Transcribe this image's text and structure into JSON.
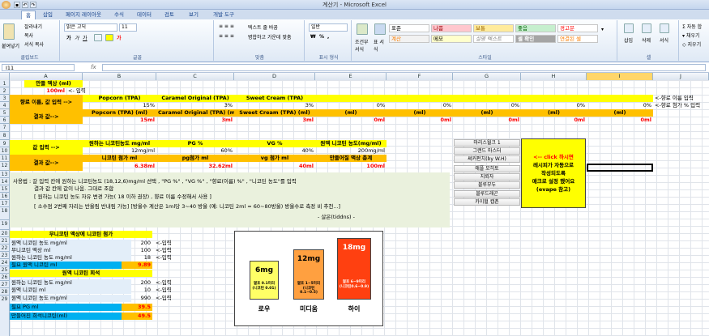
{
  "app": {
    "window_title": "계산기 - Microsoft Excel",
    "office_button": "office-orb",
    "quick_access": [
      "save-icon",
      "undo-icon",
      "redo-icon"
    ]
  },
  "ribbon": {
    "tabs": [
      "홈",
      "삽입",
      "페이지 레이아웃",
      "수식",
      "데이터",
      "검토",
      "보기",
      "개발 도구"
    ],
    "clipboard": {
      "paste": "붙여넣기",
      "cut": "잘라내기",
      "copy": "복사",
      "format_painter": "서식 복사",
      "label": "클립보드"
    },
    "font": {
      "name": "맑은 고딕",
      "size": "11",
      "label": "글꼴"
    },
    "align": {
      "wrap": "텍스트 줄 바꿈",
      "merge": "병합하고 가운데 맞춤",
      "label": "맞춤"
    },
    "number": {
      "format": "일반",
      "currency": "₩",
      "percent": "%",
      "label": "표시 형식"
    },
    "styles": {
      "conditional": "조건부 서식",
      "table": "표 서식",
      "standard": "표준",
      "bad": "나쁨",
      "good": "보통",
      "neutral": "좋음",
      "warning": "경고문",
      "calc": "계산",
      "memo": "메모",
      "explain": "설명 텍스트",
      "check": "셀 확인",
      "linked": "연결된 셀",
      "label": "스타일"
    },
    "cells": {
      "insert": "삽입",
      "delete": "삭제",
      "format": "서식",
      "label": "셀"
    },
    "editing": {
      "autosum": "자동 합",
      "fill": "채우기",
      "clear": "지우기"
    }
  },
  "formula_bar": {
    "name_box": "I11",
    "fx": "fx",
    "value": ""
  },
  "columns": [
    "A",
    "B",
    "C",
    "D",
    "E",
    "F",
    "G",
    "H",
    "I",
    "J"
  ],
  "rows": [
    "1",
    "2",
    "3",
    "4",
    "5",
    "6",
    "7",
    "8",
    "9",
    "10",
    "11",
    "12",
    "13",
    "14",
    "15",
    "16",
    "17",
    "18",
    "19",
    "20",
    "21",
    "22",
    "23",
    "24",
    "25",
    "26",
    "27",
    "28",
    "29"
  ],
  "sheet": {
    "r1": "만들 액상 (ml)",
    "r2_val": "100ml",
    "r2_note": "<- 입력",
    "r3_label": "향료 이름, 값 입력 -->",
    "r3": [
      "Popcorn (TPA)",
      "Caramel Original (TPA)",
      "Sweet Cream (TPA)"
    ],
    "r4": [
      "15%",
      "3%",
      "3%",
      "0%",
      "0%",
      "0%",
      "0%",
      "0%"
    ],
    "r5_label": "결과 값-->",
    "r5": [
      "Popcorn (TPA) (ml)",
      "Caramel Original (TPA) (ml)",
      "Sweet Cream (TPA) (ml)",
      "(ml)",
      "(ml)",
      "(ml)",
      "(ml)",
      "(ml)"
    ],
    "r6": [
      "15ml",
      "3ml",
      "3ml",
      "0ml",
      "0ml",
      "0ml",
      "0ml",
      "0ml"
    ],
    "note_r3": "<-향료 이름 입력",
    "note_r4": "<-향료 첨가 % 입력",
    "r8": [
      "원하는 니코틴농도 mg/ml",
      "PG %",
      "VG %",
      "원액 니코틴 농도(mg/ml)"
    ],
    "r9_label": "값 입력 -->",
    "r9": [
      "12mg/ml",
      "60%",
      "40%",
      "200mg/ml"
    ],
    "r10": [
      "니코틴 첨가 ml",
      "pg첨가 ml",
      "vg 첨가 ml",
      "만들어질 액상 총계"
    ],
    "r11_label": "결과 값-->",
    "r11": [
      "6.38ml",
      "32.62ml",
      "40ml",
      "100ml"
    ],
    "help": [
      "사용법 : 갈 입력 칸에 원하는 니코틴농도 (18,12,6)mg/ml 선택 , \"PG %\" , \"VG %\" , \"향료(이름) %\" , \"니코틴 농도\"를 입력",
      "결과 값 칸에 값이 나옴. 그대로 조합",
      "[ 원하는 니코틴 농도 자유 변경 가능( 18 이하 권장) , 향료 이름 수정해서 사용 ]",
      "[ 소수점 2번째 자리는 반올림 반내림 가능] [방울수 계산은 1ml당 3~40 방울 (예: 니코틴 2ml = 60~80방울) 방울수로 측정 비 추천...]",
      "- 살은(tiddns) -"
    ],
    "sec1_title": "무니코틴 액상에 니코틴 첨가",
    "sec1": [
      {
        "label": "원액 니코틴 농도 mg/ml",
        "val": "200",
        "note": "<-입력"
      },
      {
        "label": "무니코틴 액상 ml",
        "val": "100",
        "note": "<-입력"
      },
      {
        "label": "원하는 니코틴 농도 mg/ml",
        "val": "18",
        "note": "<-입력"
      },
      {
        "label": "필요 원액 니코틴 ml",
        "val": "9.89",
        "note": ""
      }
    ],
    "sec2_title": "원액 니코틴 희석",
    "sec2": [
      {
        "label": "원하는 니코틴 농도 mg/ml",
        "val": "200",
        "note": "<-입력"
      },
      {
        "label": "원액 니코틴 ml",
        "val": "10",
        "note": "<-입력"
      },
      {
        "label": "원액 니코틴 농도 mg/ml",
        "val": "990",
        "note": "<-입력"
      },
      {
        "label": "필요 PG ml",
        "val": "39.5",
        "note": ""
      },
      {
        "label": "만들어진 희석니코틴(ml)",
        "val": "49.5",
        "note": ""
      }
    ],
    "buttons": [
      "마리스월크 1",
      "그랜드 마스터",
      "써커펀치(by W.H)",
      "애플 모히토",
      "지뢰자",
      "블루부두",
      "블루드래곤",
      "카이헐 캡촌"
    ],
    "callout": [
      "<-- click 하시면",
      "레시피가 자동으로",
      "작성되도록",
      "매크로 설정 했어요",
      "(evape 참고)"
    ],
    "jars": [
      {
        "mg": "6mg",
        "t1": "옅호 0.1미리",
        "t2": "(니코틴 0.01)",
        "name": "로우",
        "color": "#ffff66"
      },
      {
        "mg": "12mg",
        "t1": "옅호 1~5미리",
        "t2": "(니코틴0.1~0.5)",
        "name": "미디움",
        "color": "#ffa040"
      },
      {
        "mg": "18mg",
        "t1": "옅호 6~9미리",
        "t2": "(니코틴0.6~0.9)",
        "name": "하이",
        "color": "#ff4010"
      }
    ]
  }
}
